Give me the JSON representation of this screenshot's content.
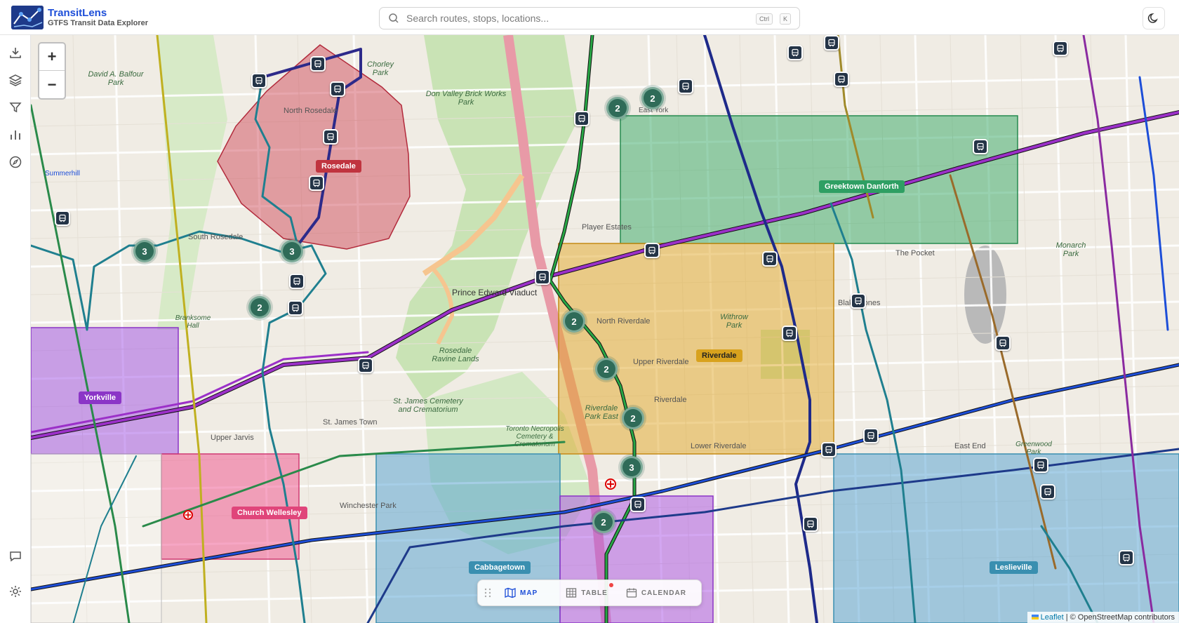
{
  "app": {
    "title": "TransitLens",
    "subtitle": "GTFS Transit Data Explorer"
  },
  "search": {
    "placeholder": "Search routes, stops, locations...",
    "kbd_ctrl": "Ctrl",
    "kbd_k": "K"
  },
  "sidebar": {
    "items": [
      {
        "name": "download-icon"
      },
      {
        "name": "layers-icon"
      },
      {
        "name": "filter-icon"
      },
      {
        "name": "chart-icon"
      },
      {
        "name": "compass-icon"
      },
      {
        "name": "chat-icon"
      },
      {
        "name": "settings-icon"
      }
    ]
  },
  "map": {
    "zoom_in": "+",
    "zoom_out": "−",
    "areas": [
      {
        "label": "Rosedale",
        "color": "#c0343f"
      },
      {
        "label": "Greektown Danforth",
        "color": "#2e9f63"
      },
      {
        "label": "Riverdale",
        "color": "#d8a21d"
      },
      {
        "label": "Yorkville",
        "color": "#8b35c7"
      },
      {
        "label": "Church Wellesley",
        "color": "#e0457a"
      },
      {
        "label": "Cabbagetown",
        "color": "#3a8fb0"
      },
      {
        "label": "Leslieville",
        "color": "#3a8fb0"
      }
    ],
    "clusters": [
      "2",
      "2",
      "3",
      "3",
      "2",
      "2",
      "2",
      "2",
      "3",
      "2"
    ],
    "places": {
      "north_rosedale": "North Rosedale",
      "south_rosedale": "South Rosedale",
      "prince_edward_viaduct": "Prince Edward Viaduct",
      "north_riverdale": "North Riverdale",
      "upper_riverdale": "Upper Riverdale",
      "riverdale": "Riverdale",
      "riverdale_park_east": "Riverdale Park East",
      "lower_riverdale": "Lower Riverdale",
      "the_pocket": "The Pocket",
      "blake_jones": "Blake-Jones",
      "east_end": "East End",
      "upper_jarvis": "Upper Jarvis",
      "st_james_town": "St. James Town",
      "winchester_park": "Winchester Park",
      "don_valley_brick_works_park": "Don Valley Brick Works Park",
      "st_james_cemetery": "St. James Cemetery and Crematorium",
      "rosedale_ravine_lands": "Rosedale Ravine Lands",
      "player_estates": "Player Estates",
      "monarch_park": "Monarch Park",
      "withrow_park": "Withrow Park",
      "toronto_necropolis": "Toronto Necropolis Cemetery & Crematorium",
      "david_balfour_park": "David A. Balfour Park",
      "chorley_park": "Chorley Park",
      "branksome_hall": "Branksome Hall",
      "greenwood_park": "Greenwood Park",
      "east_york": "East York",
      "summerhill": "Summerhill"
    }
  },
  "viewbar": {
    "map": "MAP",
    "table": "TABLE",
    "calendar": "CALENDAR"
  },
  "attribution": {
    "leaflet": "Leaflet",
    "osm": "| © OpenStreetMap contributors"
  },
  "colors": {
    "accent": "#1d4ed8",
    "stop": "#243447",
    "cluster": "#2f6b58"
  }
}
